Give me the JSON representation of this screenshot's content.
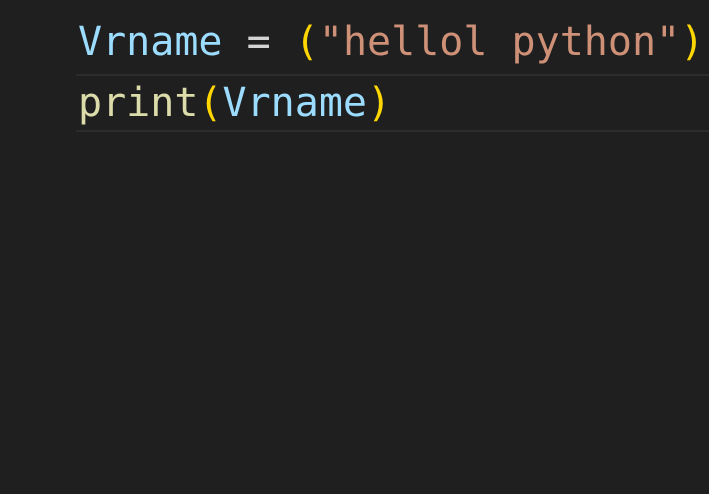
{
  "editor": {
    "background": "#1f1f1f",
    "colors": {
      "variable": "#9cdcfe",
      "operator": "#d4d4d4",
      "paren": "#ffd700",
      "string": "#ce9178",
      "function": "#dcdcaa"
    },
    "lines": [
      {
        "tokens": {
          "var": "Vrname",
          "space1": " ",
          "op": "=",
          "space2": " ",
          "lparen": "(",
          "string": "\"hellol python\"",
          "rparen": ")"
        }
      },
      {
        "tokens": {
          "func": "print",
          "lparen": "(",
          "arg": "Vrname",
          "rparen": ")"
        }
      }
    ]
  }
}
